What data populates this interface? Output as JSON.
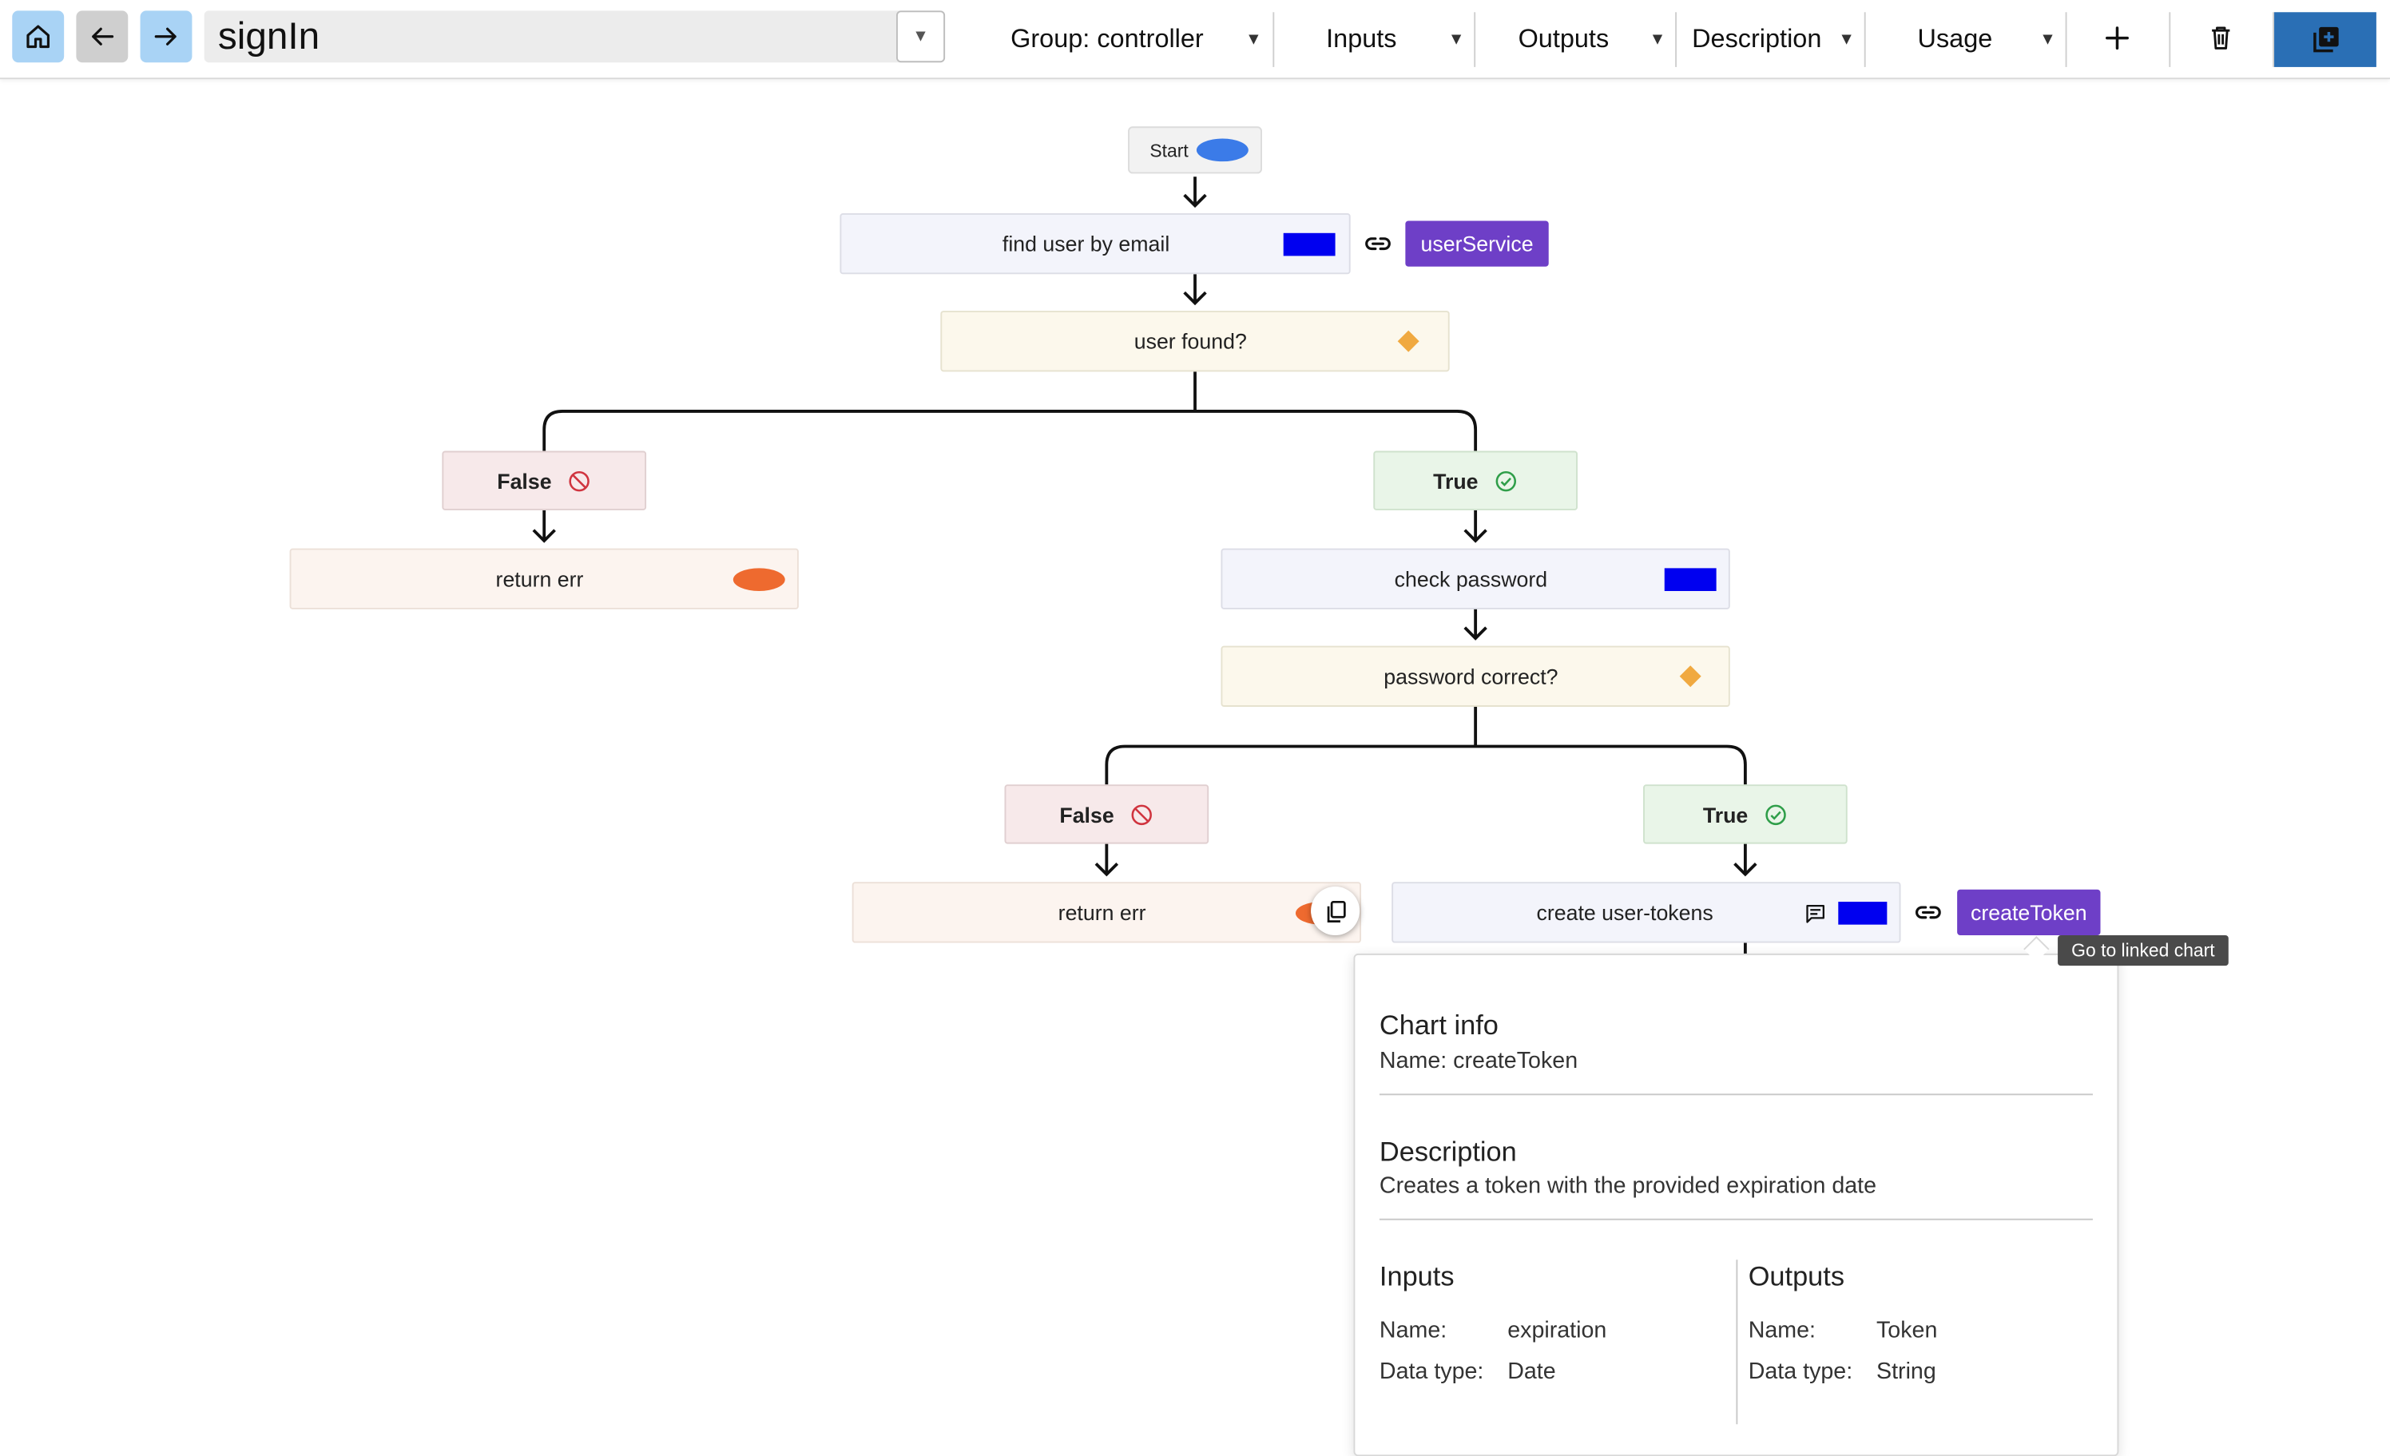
{
  "toolbar": {
    "title": "signIn",
    "group_label": "Group: controller",
    "inputs_label": "Inputs",
    "outputs_label": "Outputs",
    "description_label": "Description",
    "usage_label": "Usage",
    "dropdown_arrow": "▼"
  },
  "flow": {
    "start_label": "Start",
    "find_user_label": "find user by email",
    "user_service_tag": "userService",
    "user_found_label": "user found?",
    "false_label": "False",
    "true_label": "True",
    "return_err_label": "return err",
    "check_password_label": "check password",
    "password_correct_label": "password correct?",
    "create_tokens_label": "create user-tokens",
    "create_token_tag": "createToken"
  },
  "tooltip": {
    "text": "Go to linked chart"
  },
  "info_panel": {
    "chart_info_heading": "Chart info",
    "name_line": "Name: createToken",
    "description_heading": "Description",
    "description_text": "Creates a token with the provided expiration date",
    "inputs_heading": "Inputs",
    "outputs_heading": "Outputs",
    "name_key": "Name:",
    "datatype_key": "Data type:",
    "input_name": "expiration",
    "input_type": "Date",
    "output_name": "Token",
    "output_type": "String"
  },
  "colors": {
    "start_oval": "#3b7be8",
    "process_rect": "#0000f0",
    "decision_diamond": "#f0a940",
    "return_oval": "#ee6a2f",
    "linked_tag": "#6e3fc7",
    "false_icon": "#d0343f",
    "true_icon": "#2f9e49",
    "delete_button_active": "#2a6fb5"
  }
}
